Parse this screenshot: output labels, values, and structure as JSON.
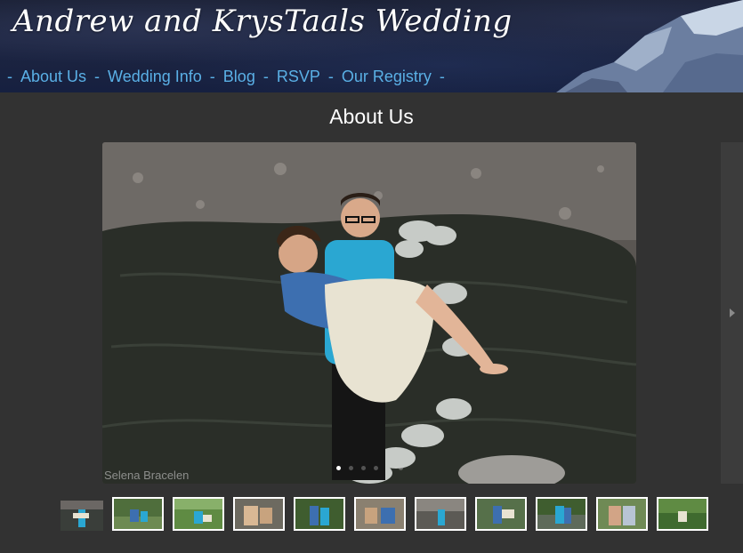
{
  "site": {
    "title": "Andrew and KrysTaals Wedding"
  },
  "nav": {
    "separator": "-",
    "items": [
      {
        "label": "About Us"
      },
      {
        "label": "Wedding Info"
      },
      {
        "label": "Blog"
      },
      {
        "label": "RSVP"
      },
      {
        "label": "Our Registry"
      }
    ]
  },
  "main": {
    "title": "About Us",
    "photo": {
      "watermark": "Selena Bracelen",
      "slide_count": 6,
      "active_slide": 0
    },
    "thumbnail_count": 12,
    "active_thumbnail": 0
  },
  "colors": {
    "background": "#323232",
    "nav_link": "#5ab0e6",
    "header_bg": "#1b2136",
    "thumb_border": "#ffffff"
  }
}
